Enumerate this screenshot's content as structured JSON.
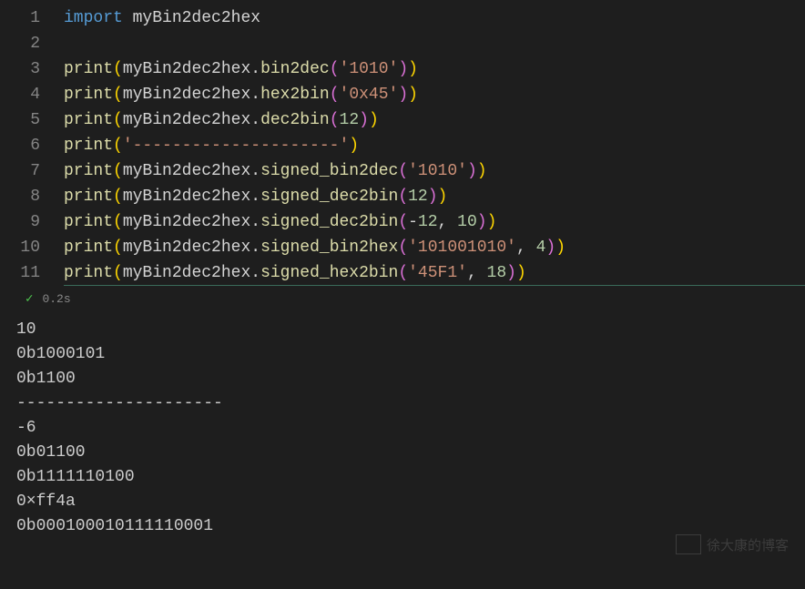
{
  "code": {
    "lines": [
      {
        "n": "1",
        "tokens": [
          [
            "kw-import",
            "import"
          ],
          [
            "",
            ". "
          ],
          [
            "module",
            "myBin2dec2hex"
          ]
        ]
      },
      {
        "n": "2",
        "tokens": []
      },
      {
        "n": "3",
        "tokens": [
          [
            "func",
            "print"
          ],
          [
            "paren",
            "("
          ],
          [
            "module",
            "myBin2dec2hex"
          ],
          [
            "dot",
            "."
          ],
          [
            "func",
            "bin2dec"
          ],
          [
            "bracket1",
            "("
          ],
          [
            "str",
            "'1010'"
          ],
          [
            "bracket1",
            ")"
          ],
          [
            "paren",
            ")"
          ]
        ]
      },
      {
        "n": "4",
        "tokens": [
          [
            "func",
            "print"
          ],
          [
            "paren",
            "("
          ],
          [
            "module",
            "myBin2dec2hex"
          ],
          [
            "dot",
            "."
          ],
          [
            "func",
            "hex2bin"
          ],
          [
            "bracket1",
            "("
          ],
          [
            "str",
            "'0x45'"
          ],
          [
            "bracket1",
            ")"
          ],
          [
            "paren",
            ")"
          ]
        ]
      },
      {
        "n": "5",
        "tokens": [
          [
            "func",
            "print"
          ],
          [
            "paren",
            "("
          ],
          [
            "module",
            "myBin2dec2hex"
          ],
          [
            "dot",
            "."
          ],
          [
            "func",
            "dec2bin"
          ],
          [
            "bracket1",
            "("
          ],
          [
            "num",
            "12"
          ],
          [
            "bracket1",
            ")"
          ],
          [
            "paren",
            ")"
          ]
        ]
      },
      {
        "n": "6",
        "tokens": [
          [
            "func",
            "print"
          ],
          [
            "paren",
            "("
          ],
          [
            "str",
            "'---------------------'"
          ],
          [
            "paren",
            ")"
          ]
        ]
      },
      {
        "n": "7",
        "tokens": [
          [
            "func",
            "print"
          ],
          [
            "paren",
            "("
          ],
          [
            "module",
            "myBin2dec2hex"
          ],
          [
            "dot",
            "."
          ],
          [
            "func",
            "signed_bin2dec"
          ],
          [
            "bracket1",
            "("
          ],
          [
            "str",
            "'1010'"
          ],
          [
            "bracket1",
            ")"
          ],
          [
            "paren",
            ")"
          ]
        ]
      },
      {
        "n": "8",
        "tokens": [
          [
            "func",
            "print"
          ],
          [
            "paren",
            "("
          ],
          [
            "module",
            "myBin2dec2hex"
          ],
          [
            "dot",
            "."
          ],
          [
            "func",
            "signed_dec2bin"
          ],
          [
            "bracket1",
            "("
          ],
          [
            "num",
            "12"
          ],
          [
            "bracket1",
            ")"
          ],
          [
            "paren",
            ")"
          ]
        ]
      },
      {
        "n": "9",
        "tokens": [
          [
            "func",
            "print"
          ],
          [
            "paren",
            "("
          ],
          [
            "module",
            "myBin2dec2hex"
          ],
          [
            "dot",
            "."
          ],
          [
            "func",
            "signed_dec2bin"
          ],
          [
            "bracket1",
            "("
          ],
          [
            "op",
            "-"
          ],
          [
            "num",
            "12"
          ],
          [
            "comma",
            ", "
          ],
          [
            "num",
            "10"
          ],
          [
            "bracket1",
            ")"
          ],
          [
            "paren",
            ")"
          ]
        ]
      },
      {
        "n": "10",
        "tokens": [
          [
            "func",
            "print"
          ],
          [
            "paren",
            "("
          ],
          [
            "module",
            "myBin2dec2hex"
          ],
          [
            "dot",
            "."
          ],
          [
            "func",
            "signed_bin2hex"
          ],
          [
            "bracket1",
            "("
          ],
          [
            "str",
            "'101001010'"
          ],
          [
            "comma",
            ", "
          ],
          [
            "num",
            "4"
          ],
          [
            "bracket1",
            ")"
          ],
          [
            "paren",
            ")"
          ]
        ]
      },
      {
        "n": "11",
        "tokens": [
          [
            "func",
            "print"
          ],
          [
            "paren",
            "("
          ],
          [
            "module",
            "myBin2dec2hex"
          ],
          [
            "dot",
            "."
          ],
          [
            "func",
            "signed_hex2bin"
          ],
          [
            "bracket1",
            "("
          ],
          [
            "str",
            "'45F1'"
          ],
          [
            "comma",
            ", "
          ],
          [
            "num",
            "18"
          ],
          [
            "bracket1",
            ")"
          ],
          [
            "paren",
            ")"
          ]
        ]
      }
    ],
    "activeLine": 11
  },
  "status": {
    "check": "✓",
    "time": "0.2s"
  },
  "output": [
    "10",
    "0b1000101",
    "0b1100",
    "---------------------",
    "-6",
    "0b01100",
    "0b1111110100",
    "0×ff4a",
    "0b000100010111110001"
  ],
  "watermark": "徐大康的博客"
}
